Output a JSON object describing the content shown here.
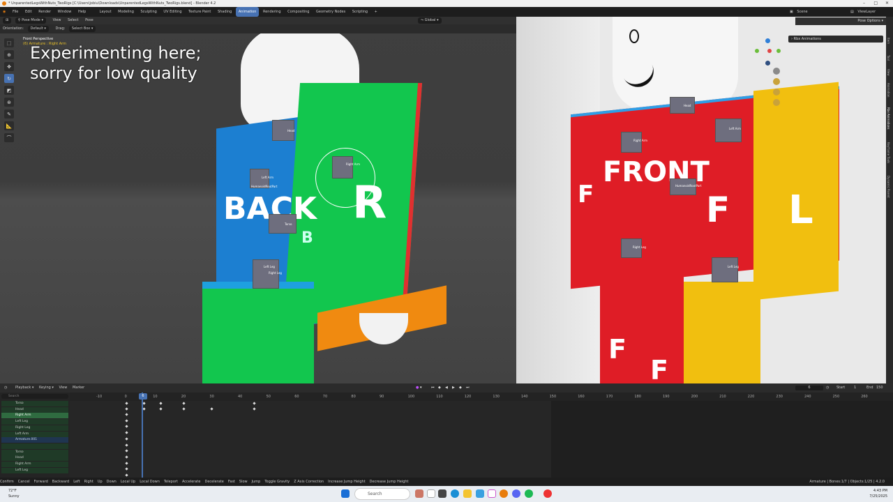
{
  "window": {
    "title": "* UnparentedLegsWithNuts_TwoRigs [C:\\Users\\jobiu\\Downloads\\UnparentedLegsWithNuts_TwoRigs.blend] - Blender 4.2"
  },
  "menu": {
    "items": [
      "File",
      "Edit",
      "Render",
      "Window",
      "Help"
    ],
    "workspaces": [
      "Layout",
      "Modeling",
      "Sculpting",
      "UV Editing",
      "Texture Paint",
      "Shading",
      "Animation",
      "Rendering",
      "Compositing",
      "Geometry Nodes",
      "Scripting"
    ],
    "active_workspace": "Animation",
    "add": "+",
    "scene": "Scene",
    "view_layer": "ViewLayer"
  },
  "viewport_header": {
    "mode": "Pose Mode",
    "view": "View",
    "select": "Select",
    "pose": "Pose",
    "transform": "Global",
    "orientation_label": "Orientation:",
    "orientation_value": "Default",
    "drag_label": "Drag:",
    "drag_value": "Select Box",
    "pose_options": "Pose Options"
  },
  "viewport_info": {
    "line1": "Front Perspective",
    "line2": "(6) Armature : Right Arm"
  },
  "overlay_text": {
    "line1": "Experimenting here;",
    "line2": "sorry for low quality"
  },
  "model_left": {
    "back": "BACK",
    "r": "R",
    "b": "B"
  },
  "model_right": {
    "front": "FRONT",
    "f": "F",
    "l": "L"
  },
  "bones_left": [
    "Head",
    "Left Arm",
    "HumanoidRootPart",
    "Torso",
    "Left Leg",
    "Right Leg",
    "Right Arm"
  ],
  "bones_right": [
    "Head",
    "Right Arm",
    "Left Arm",
    "HumanoidRootPart",
    "Right Leg",
    "Left Leg"
  ],
  "npanel": {
    "title": "Rbx Animations"
  },
  "side_tabs": [
    "Item",
    "Tool",
    "View",
    "Animation",
    "Rbx Animations",
    "Keyframe Tools",
    "Dynamic Parent"
  ],
  "timeline": {
    "playback": "Playback",
    "keying": "Keying",
    "view": "View",
    "marker": "Marker",
    "current_frame": "6",
    "start_label": "Start",
    "start": "1",
    "end_label": "End",
    "end": "150",
    "playhead": "6",
    "ruler": [
      "-10",
      "0",
      "10",
      "20",
      "30",
      "40",
      "50",
      "60",
      "70",
      "80",
      "90",
      "100",
      "110",
      "120",
      "130",
      "140",
      "150",
      "160",
      "170",
      "180",
      "190",
      "200",
      "210",
      "220",
      "230",
      "240",
      "250",
      "260"
    ],
    "channels": [
      {
        "label": "Torso",
        "type": "bone"
      },
      {
        "label": "Head",
        "type": "bone"
      },
      {
        "label": "Right Arm",
        "type": "bone"
      },
      {
        "label": "Left Leg",
        "type": "bone"
      },
      {
        "label": "Right Leg",
        "type": "bone"
      },
      {
        "label": "Left Arm",
        "type": "bone"
      },
      {
        "label": "Armature.001",
        "type": "arm"
      },
      {
        "label": "",
        "type": "bone"
      },
      {
        "label": "Torso",
        "type": "bone"
      },
      {
        "label": "Head",
        "type": "bone"
      },
      {
        "label": "Right Arm",
        "type": "bone"
      },
      {
        "label": "Left Leg",
        "type": "bone"
      }
    ],
    "search_placeholder": "Search"
  },
  "statusbar": {
    "items": [
      "Confirm",
      "Cancel",
      "Forward",
      "Backward",
      "Left",
      "Right",
      "Up",
      "Down",
      "Local Up",
      "Local Down",
      "Teleport",
      "Accelerate",
      "Decelerate",
      "Fast",
      "Slow",
      "Jump",
      "Toggle Gravity",
      "Z Axis Correction",
      "Increase Jump Height",
      "Decrease Jump Height"
    ],
    "right": "Armature | Bones:1/7 | Objects:1/25 | 4.2.0"
  },
  "taskbar": {
    "search": "Search",
    "weather_temp": "72°F",
    "weather_desc": "Sunny",
    "time": "4:43 PM",
    "date": "7/25/2025"
  }
}
